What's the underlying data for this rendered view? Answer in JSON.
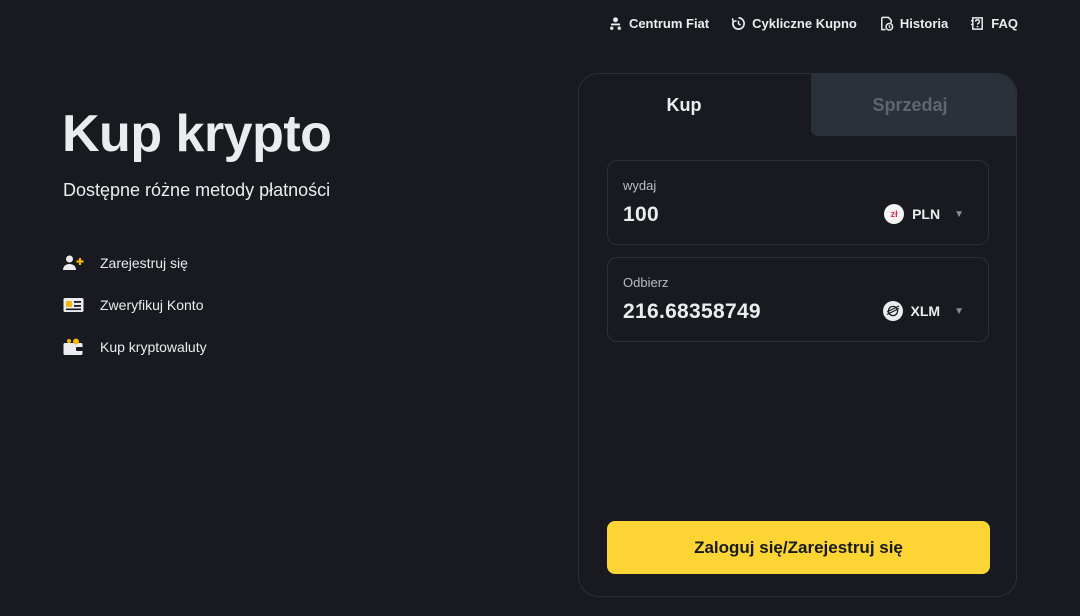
{
  "nav": {
    "items": [
      {
        "label": "Centrum Fiat",
        "icon": "fiat-center-icon"
      },
      {
        "label": "Cykliczne Kupno",
        "icon": "recurring-icon"
      },
      {
        "label": "Historia",
        "icon": "history-icon"
      },
      {
        "label": "FAQ",
        "icon": "faq-icon"
      }
    ]
  },
  "hero": {
    "title": "Kup krypto",
    "subtitle": "Dostępne różne metody płatności",
    "steps": [
      {
        "label": "Zarejestruj się",
        "icon": "add-user-icon"
      },
      {
        "label": "Zweryfikuj Konto",
        "icon": "id-card-icon"
      },
      {
        "label": "Kup kryptowaluty",
        "icon": "wallet-icon"
      }
    ]
  },
  "card": {
    "tabs": {
      "buy": "Kup",
      "sell": "Sprzedaj",
      "active": "buy"
    },
    "spend": {
      "label": "wydaj",
      "value": "100",
      "currency": "PLN",
      "currency_symbol": "zł"
    },
    "receive": {
      "label": "Odbierz",
      "value": "216.68358749",
      "currency": "XLM"
    },
    "cta_label": "Zaloguj się/Zarejestruj się"
  },
  "colors": {
    "background": "#181a20",
    "accent": "#fcd535",
    "border": "#2b3139",
    "muted": "#5e6673"
  }
}
